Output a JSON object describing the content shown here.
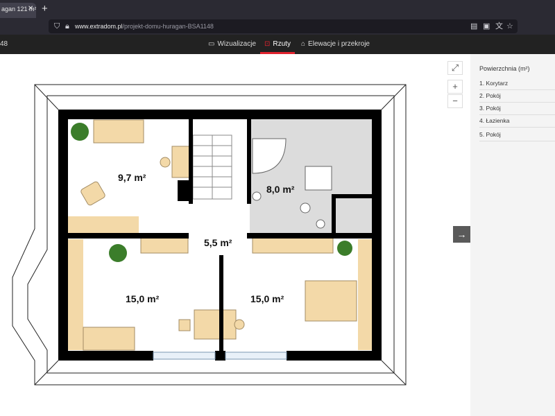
{
  "browser": {
    "tab_title": "agan 121 m²",
    "tab_close": "✕",
    "new_tab": "+",
    "url_host": "www.extradom.pl",
    "url_path": "/projekt-domu-huragan-BSA1148"
  },
  "site": {
    "code": "48",
    "tabs": [
      {
        "label": "Wizualizacje",
        "icon": "monitor-icon"
      },
      {
        "label": "Rzuty",
        "icon": "floorplan-icon",
        "active": true
      },
      {
        "label": "Elewacje i przekroje",
        "icon": "house-icon"
      }
    ]
  },
  "plan": {
    "rooms": [
      {
        "area": "9,7 m²"
      },
      {
        "area": "8,0 m²"
      },
      {
        "area": "5,5 m²"
      },
      {
        "area": "15,0 m²"
      },
      {
        "area": "15,0 m²"
      }
    ]
  },
  "controls": {
    "zoom_in": "+",
    "zoom_out": "−",
    "next": "→"
  },
  "panel": {
    "title": "Powierzchnia (m²)",
    "items": [
      "1. Korytarz",
      "2. Pokój",
      "3. Pokój",
      "4. Łazienka",
      "5. Pokój"
    ]
  },
  "colors": {
    "accent": "#e1232f",
    "wall": "#000000",
    "furniture": "#f3d9a8",
    "bathroom": "#dcdcdc"
  }
}
